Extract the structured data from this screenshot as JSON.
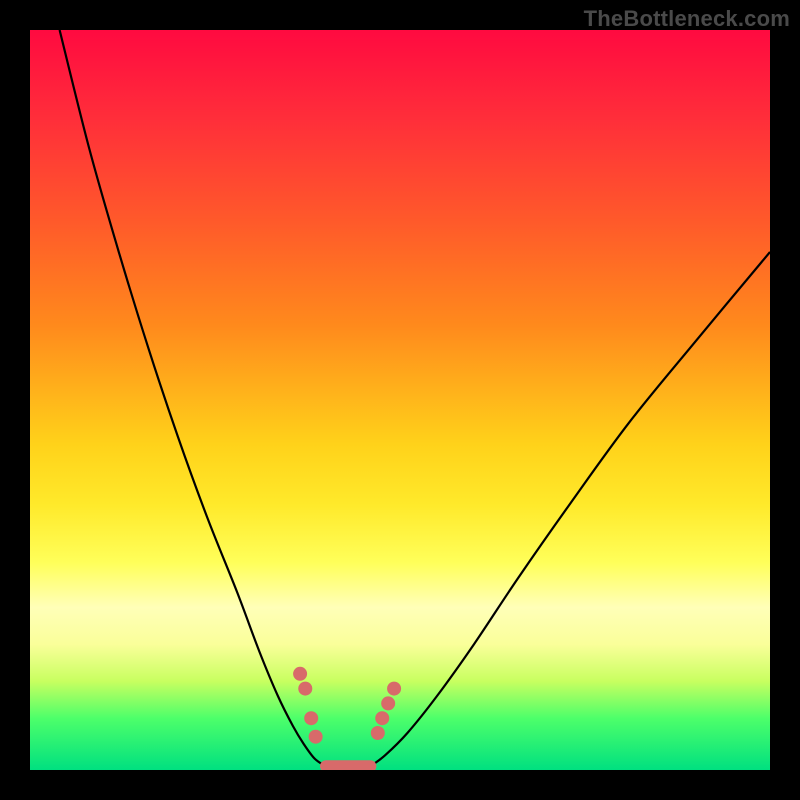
{
  "watermark": "TheBottleneck.com",
  "chart_data": {
    "type": "line",
    "title": "",
    "xlabel": "",
    "ylabel": "",
    "xlim": [
      0,
      100
    ],
    "ylim": [
      0,
      100
    ],
    "series": [
      {
        "name": "left-curve",
        "x": [
          4,
          8,
          12,
          16,
          20,
          24,
          28,
          31,
          33.5,
          35.5,
          37,
          38.5,
          40
        ],
        "values": [
          100,
          84,
          70,
          57,
          45,
          34,
          24,
          16,
          10,
          6,
          3.5,
          1.5,
          0.5
        ]
      },
      {
        "name": "right-curve",
        "x": [
          46,
          48,
          51,
          55,
          60,
          66,
          73,
          81,
          90,
          100
        ],
        "values": [
          0.5,
          2,
          5,
          10,
          17,
          26,
          36,
          47,
          58,
          70
        ]
      },
      {
        "name": "bottom-segment",
        "x": [
          40,
          46
        ],
        "values": [
          0.5,
          0.5
        ]
      }
    ],
    "markers": [
      {
        "series": "left-curve",
        "x": 36.5,
        "y": 13
      },
      {
        "series": "left-curve",
        "x": 37.2,
        "y": 11
      },
      {
        "series": "left-curve",
        "x": 38.0,
        "y": 7
      },
      {
        "series": "left-curve",
        "x": 38.6,
        "y": 4.5
      },
      {
        "series": "right-curve",
        "x": 47.0,
        "y": 5
      },
      {
        "series": "right-curve",
        "x": 47.6,
        "y": 7
      },
      {
        "series": "right-curve",
        "x": 48.4,
        "y": 9
      },
      {
        "series": "right-curve",
        "x": 49.2,
        "y": 11
      }
    ],
    "annotations": [],
    "grid": false,
    "legend": false
  },
  "colors": {
    "gradient_top": "#ff0a40",
    "gradient_bottom": "#00e080",
    "curve": "#000000",
    "marker": "#d86a6a"
  }
}
